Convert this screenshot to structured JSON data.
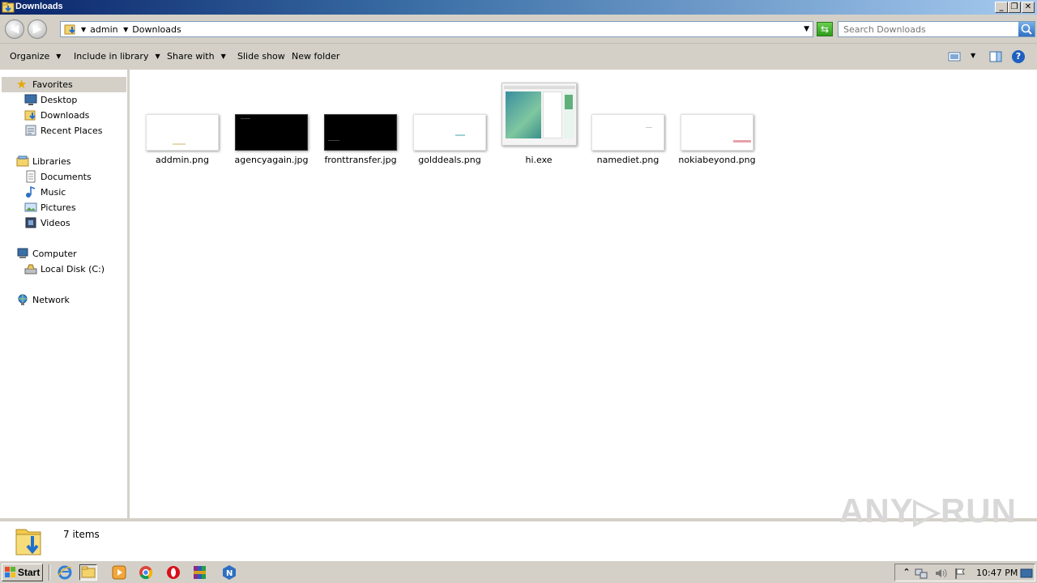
{
  "window": {
    "title": "Downloads",
    "controls": {
      "minimize": "_",
      "restore": "❐",
      "close": "✕"
    }
  },
  "address": {
    "crumbs": [
      "admin",
      "Downloads"
    ],
    "search_placeholder": "Search Downloads"
  },
  "toolbar": {
    "organize": "Organize",
    "include_in_library": "Include in library",
    "share_with": "Share with",
    "slide_show": "Slide show",
    "new_folder": "New folder",
    "help": "?"
  },
  "nav": {
    "favorites": {
      "label": "Favorites",
      "items": [
        "Desktop",
        "Downloads",
        "Recent Places"
      ]
    },
    "libraries": {
      "label": "Libraries",
      "items": [
        "Documents",
        "Music",
        "Pictures",
        "Videos"
      ]
    },
    "computer": {
      "label": "Computer",
      "items": [
        "Local Disk (C:)"
      ]
    },
    "network": {
      "label": "Network"
    }
  },
  "files": [
    {
      "name": "addmin.png",
      "thumb": "light"
    },
    {
      "name": "agencyagain.jpg",
      "thumb": "dark"
    },
    {
      "name": "fronttransfer.jpg",
      "thumb": "dark"
    },
    {
      "name": "golddeals.png",
      "thumb": "light"
    },
    {
      "name": "hi.exe",
      "thumb": "app"
    },
    {
      "name": "namediet.png",
      "thumb": "light"
    },
    {
      "name": "nokiabeyond.png",
      "thumb": "light"
    }
  ],
  "status": {
    "item_count": "7 items"
  },
  "watermark": "ANY▷RUN",
  "taskbar": {
    "start": "Start",
    "clock": "10:47 PM"
  },
  "colors": {
    "title_start": "#0a246a",
    "title_end": "#a6caf0",
    "chrome": "#d4d0c8"
  }
}
